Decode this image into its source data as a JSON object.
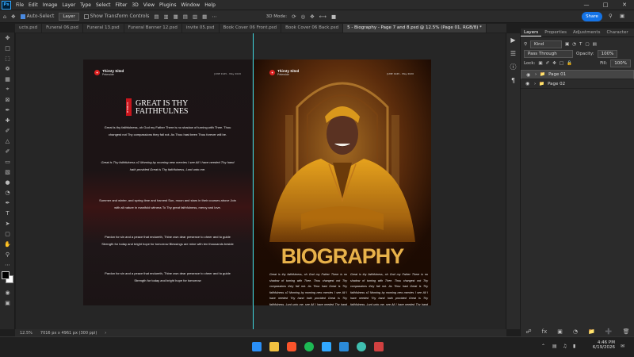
{
  "menubar": {
    "app_icon": "Ps",
    "items": [
      "File",
      "Edit",
      "Image",
      "Layer",
      "Type",
      "Select",
      "Filter",
      "3D",
      "View",
      "Plugins",
      "Window",
      "Help"
    ]
  },
  "options": {
    "auto_select": "Auto-Select",
    "layer_select": "Layer",
    "show_transform": "Show Transform Controls",
    "mode_3d": "3D Mode:",
    "share": "Share"
  },
  "tabs": [
    "ucts.psd",
    "Funeral 06.psd",
    "Funeral 13.psd",
    "Funeral Banner 12.psd",
    "invite 05.psd",
    "Book Cover 06 Front.psd",
    "Book Cover 06 Back.psd",
    "5 - Biography - Page 7 and 8.psd @ 12.5% (Page 01, RGB/8) *"
  ],
  "doc_left": {
    "brand": "Thirsty Sited",
    "brand_sub": "Peterside",
    "date_text": "JUNE 1945 - May 2020",
    "badge": "HYMN 01",
    "heading_line1": "GREAT IS THY",
    "heading_line2": "FAITHFULNES",
    "paragraphs": [
      "Great is thy faithfulness, oh God my Father There is no shadow of turning with Thee. Thou changest not Thy compassions they fail not. As Thou hast been Thou forever will be.",
      "Great is Thy faithfulness x2 Morning by morning new mercies I see All I have needed Thy hand hath provided Great is Thy faithfulness, Lord unto me.",
      "Summer and winter, and spring time and harvest Sun, moon and stars in their courses above Join with all nature in manifold witness To Thy great faithfulness, mercy and love.",
      "Pardon for sin and a peace that endureth, Thine own dear presence to cheer and to guide Strength for today and bright hope for tomorrow Blessings are mine with ten thousands beside",
      "Pardon for sin and a peace that endureth, Thine own dear presence to cheer and to guide Strength for today and bright hope for tomorrow"
    ]
  },
  "doc_right": {
    "brand": "Thirsty Sited",
    "brand_sub": "Peterside",
    "date_text": "JUNE 1945 - May 2020",
    "title": "BIOGRAPHY",
    "col1": "Great is thy faithfulness, oh God my Father There is no shadow of turning with Thee. Thou changest not Thy compassions they fail not. As Thou hast Great is Thy faithfulness x2 Morning by morning new mercies I see All I have needed Thy hand hath provided Great is Thy faithfulness, Lord unto me. see All I have needed Thy hand hath provided Great is Thy faithfulness see All I have needed Thy",
    "col2": "Great is thy faithfulness, oh God my Father There is no shadow of turning with Thee. Thou changest not Thy compassions they fail not. As Thou hast Great is Thy faithfulness x2 Morning by morning new mercies I see All I have needed Thy hand hath provided Great is Thy faithfulness, Lord unto me. see All I have needed Thy hand hath provided Great is Thy faithfulness see All I have needed Thy"
  },
  "status": {
    "zoom": "12.5%",
    "doc_size": "7016 px x 4961 px (300 ppi)"
  },
  "panel": {
    "tabs": [
      "Layers",
      "Properties",
      "Adjustments",
      "Character"
    ],
    "kind": "Kind",
    "blend": "Pass Through",
    "opacity_label": "Opacity:",
    "opacity": "100%",
    "lock_label": "Lock:",
    "fill_label": "Fill:",
    "fill": "100%",
    "layers": [
      "Page 01",
      "Page 02"
    ]
  },
  "taskbar": {
    "time": "4:46 PM",
    "date": "6/19/2026"
  }
}
